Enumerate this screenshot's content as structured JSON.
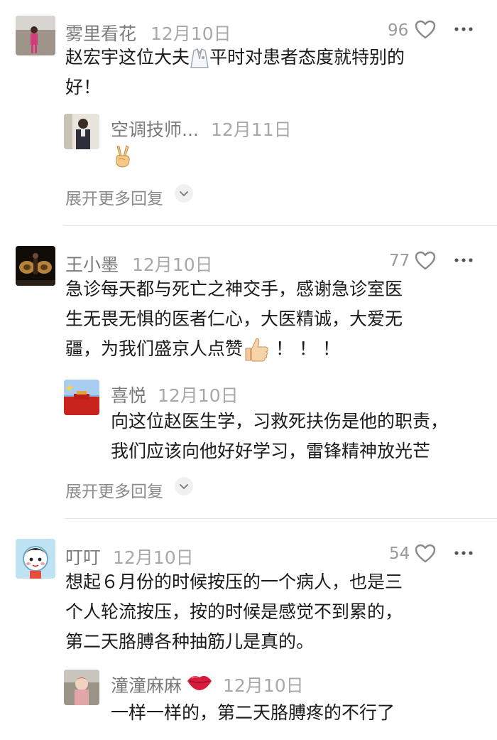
{
  "comments": [
    {
      "author": "雾里看花",
      "date": "12月10日",
      "likes": "96",
      "text_line1": "赵宏宇这位大夫",
      "text_line1b": "平时对患者态度就特别的",
      "text_line2": "好！",
      "reply": {
        "author": "空调技师...",
        "date": "12月11日",
        "emoji": "victory-hand"
      },
      "expand": "展开更多回复"
    },
    {
      "author": "王小墨",
      "date": "12月10日",
      "likes": "77",
      "text_line1": "急诊每天都与死亡之神交手，感谢急诊室医",
      "text_line2": "生无畏无惧的医者仁心，大医精诚，大爱无",
      "text_line3a": "疆，为我们盛京人点赞",
      "text_line3b": "！！！",
      "reply": {
        "author": "喜悦",
        "date": "12月10日",
        "text_line1": "向这位赵医生学，习救死扶伤是他的职责，",
        "text_line2": "我们应该向他好好学习，雷锋精神放光芒"
      },
      "expand": "展开更多回复"
    },
    {
      "author": "叮叮",
      "date": "12月10日",
      "likes": "54",
      "text_line1": "想起６月份的时候按压的一个病人，也是三",
      "text_line2": "个人轮流按压，按的时候是感觉不到累的，",
      "text_line3": "第二天胳膊各种抽筋儿是真的。",
      "reply": {
        "author": "潼潼麻麻",
        "date": "12月10日",
        "text_line1": "一样一样的，第二天胳膊疼的不行了"
      }
    }
  ],
  "colors": {
    "heart": "#9a9a9a",
    "text": "#1a1a1a",
    "meta": "#a8a8a8"
  }
}
